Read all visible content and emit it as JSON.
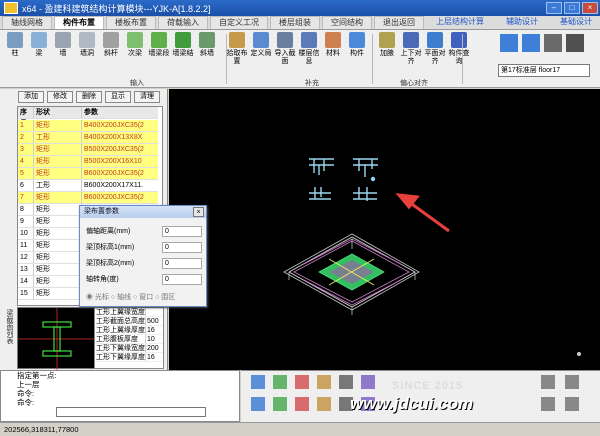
{
  "window": {
    "title": "x64 - 盈建科建筑结构计算模块---YJK-A[1.8.2.2]"
  },
  "tabs": [
    "轴线网格",
    "构件布置",
    "楼板布置",
    "荷载输入",
    "自定义工况",
    "楼层组装",
    "空间结构",
    "退出返回"
  ],
  "active_tab_index": 1,
  "right_tabs": [
    "上层结构计算",
    "辅助设计",
    "基础设计"
  ],
  "ribbon": {
    "buttons": [
      "柱",
      "梁",
      "墙",
      "墙洞",
      "斜杆",
      "次梁",
      "墙梁段",
      "墙梁结",
      "斜墙",
      "拾取布置",
      "定义局",
      "导入截面",
      "楼层信息",
      "材料",
      "构件",
      "加腋",
      "上下对齐",
      "平面对齐",
      "构件查询"
    ],
    "groups": [
      "输入",
      "补充",
      "偏心对齐"
    ],
    "floor_select": "第17标准层 floor17"
  },
  "left_panel": {
    "buttons": [
      "添加",
      "修改",
      "删除",
      "显示",
      "清理"
    ],
    "headers": [
      "序号",
      "形状",
      "参数"
    ],
    "rows": [
      {
        "n": "1",
        "shape": "矩形",
        "param": "B400X200JXC35(2",
        "hl": true
      },
      {
        "n": "2",
        "shape": "工形",
        "param": "B400X200X13X8X",
        "hl": true
      },
      {
        "n": "3",
        "shape": "矩形",
        "param": "B500X200JXC35(2",
        "hl": true
      },
      {
        "n": "4",
        "shape": "矩形",
        "param": "B500X200X16X10",
        "hl": true
      },
      {
        "n": "5",
        "shape": "矩形",
        "param": "B600X200JXC35(2",
        "hl": true
      },
      {
        "n": "6",
        "shape": "工形",
        "param": "B600X200X17X11.",
        "hl": false
      },
      {
        "n": "7",
        "shape": "矩形",
        "param": "B600X200JXC35(2",
        "hl": true
      },
      {
        "n": "8",
        "shape": "矩形",
        "param": "",
        "hl": false
      },
      {
        "n": "9",
        "shape": "矩形",
        "param": "",
        "hl": false
      },
      {
        "n": "10",
        "shape": "矩形",
        "param": "",
        "hl": false
      },
      {
        "n": "11",
        "shape": "矩形",
        "param": "",
        "hl": false
      },
      {
        "n": "12",
        "shape": "矩形",
        "param": "",
        "hl": false
      },
      {
        "n": "13",
        "shape": "矩形",
        "param": "",
        "hl": false
      },
      {
        "n": "14",
        "shape": "矩形",
        "param": "",
        "hl": false
      },
      {
        "n": "15",
        "shape": "矩形",
        "param": "",
        "hl": false
      }
    ],
    "side_title": "梁截面列表",
    "param_rows": [
      {
        "label": "工形上翼缘宽度",
        "value": ""
      },
      {
        "label": "工形截面总高度",
        "value": "500"
      },
      {
        "label": "工形上翼缘厚度",
        "value": "16"
      },
      {
        "label": "工形腹板厚度",
        "value": "10"
      },
      {
        "label": "工形下翼缘宽度",
        "value": "200"
      },
      {
        "label": "工形下翼缘厚度",
        "value": "16"
      }
    ]
  },
  "dialog": {
    "title": "梁布置参数",
    "close": "×",
    "fields": [
      {
        "label": "偏轴距离(mm)",
        "value": "0"
      },
      {
        "label": "梁顶标高1(mm)",
        "value": "0"
      },
      {
        "label": "梁顶标高2(mm)",
        "value": "0"
      },
      {
        "label": "轴转角(度)",
        "value": "0"
      }
    ],
    "radios": "◉ 光标  ○ 轴线  ○ 窗口  ○ 围区"
  },
  "command": {
    "lines": [
      "指定第一点:",
      "上一层",
      "命令:",
      "命令:"
    ]
  },
  "status": {
    "coords": "202566,318311,77800"
  },
  "watermark": {
    "since": "SINCE 2015",
    "site": "www.jdcui.com"
  },
  "colors": {
    "accent": "#1f56c4",
    "highlight": "#ffff80",
    "canvas": "#000000",
    "model": "#9ad8f0",
    "arrow": "#e8403c"
  }
}
